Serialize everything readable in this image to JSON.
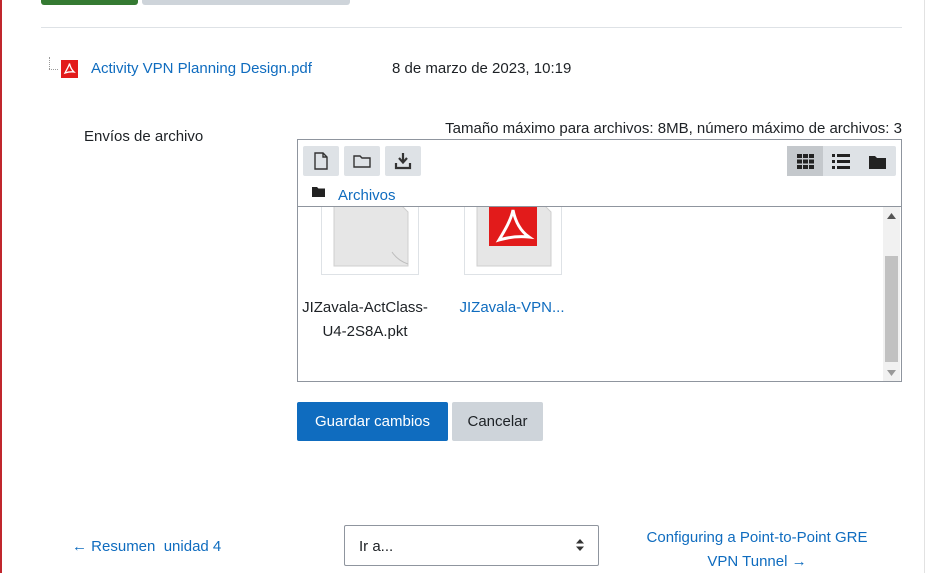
{
  "existing_file": {
    "name": "Activity VPN Planning Design.pdf",
    "date": "8 de marzo de 2023, 10:19"
  },
  "form": {
    "field_label": "Envíos de archivo",
    "max_info": "Tamaño máximo para archivos: 8MB, número máximo de archivos: 3"
  },
  "filemanager": {
    "toolbar": {
      "add_file_icon": "file-icon",
      "create_folder_icon": "folder-icon",
      "download_icon": "download-icon",
      "views": [
        "grid-view-icon",
        "list-view-icon",
        "tree-view-icon"
      ],
      "active_view": "grid-view-icon"
    },
    "path_label": "Archivos",
    "files": [
      {
        "name": "JIZavala-ActClass-U4-2S8A.pkt",
        "type": "generic-file-icon"
      },
      {
        "name": "JIZavala-VPN...",
        "type": "pdf-file-icon"
      }
    ]
  },
  "buttons": {
    "save": "Guardar cambios",
    "cancel": "Cancelar"
  },
  "navigation": {
    "prev": "Resumen  unidad 4",
    "goto": "Ir a...",
    "next": "Configuring a Point-to-Point GRE VPN Tunnel"
  },
  "colors": {
    "link": "#0f6cbf",
    "primary": "#0f6cbf",
    "secondary": "#ced4da",
    "pdf_red": "#e21b1b",
    "left_rule": "#c0262d",
    "top_button": "#357a32"
  }
}
